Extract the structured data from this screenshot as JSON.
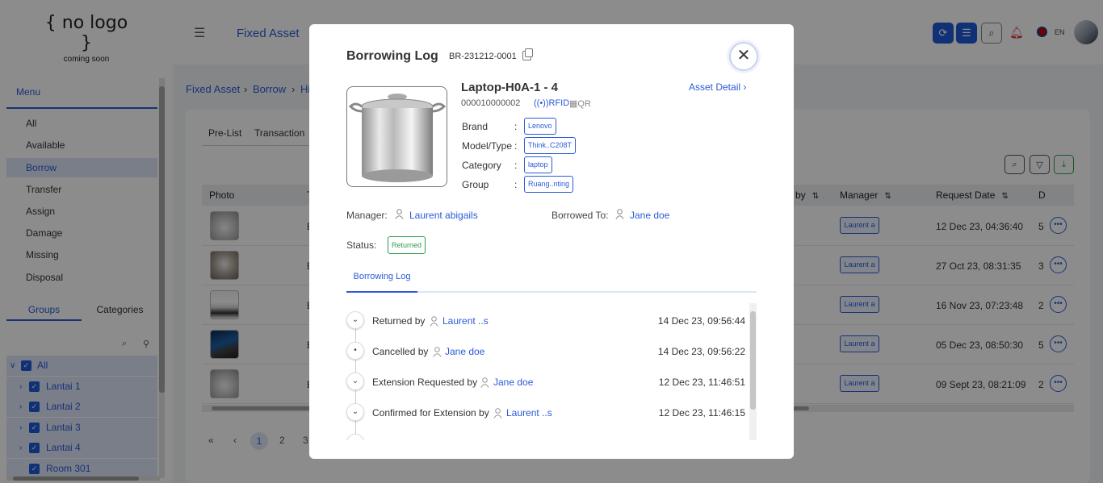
{
  "header": {
    "logo_line1": "{ no logo }",
    "logo_line2": "coming soon",
    "app_title": "Fixed Asset",
    "language": "EN"
  },
  "sidebar": {
    "menu_title": "Menu",
    "items": [
      "All",
      "Available",
      "Borrow",
      "Transfer",
      "Assign",
      "Damage",
      "Missing",
      "Disposal"
    ],
    "tabs": [
      "Groups",
      "Categories"
    ],
    "tree": [
      "All",
      "Lantai 1",
      "Lantai 2",
      "Lantai 3",
      "Lantai 4",
      "Room 301"
    ]
  },
  "main": {
    "breadcrumb": [
      "Fixed Asset",
      "Borrow",
      "Hi"
    ],
    "tabs": [
      "Pre-List",
      "Transaction"
    ],
    "table_headers": [
      "Photo",
      "T",
      "by",
      "Manager",
      "Request Date",
      "D"
    ],
    "rows": [
      {
        "b": "E",
        "manager": "Laurent a",
        "date": "12 Dec 23, 04:36:40",
        "d": "5"
      },
      {
        "b": "E",
        "manager": "Laurent a",
        "date": "27 Oct 23, 08:31:35",
        "d": "3"
      },
      {
        "b": "E",
        "manager": "Laurent a",
        "date": "16 Nov 23, 07:23:48",
        "d": "2"
      },
      {
        "b": "E",
        "manager": "Laurent a",
        "date": "05 Dec 23, 08:50:30",
        "d": "5"
      },
      {
        "b": "E",
        "manager": "Laurent a",
        "date": "09 Sept 23, 08:21:09",
        "d": "2"
      }
    ],
    "pagination": [
      "1",
      "2",
      "3"
    ]
  },
  "modal": {
    "title": "Borrowing Log",
    "code": "BR-231212-0001",
    "asset_name": "Laptop-H0A-1 - 4",
    "serial": "000010000002",
    "rfid_label": "RFID",
    "qr_label": "QR",
    "asset_detail": "Asset Detail",
    "attributes": [
      {
        "label": "Brand",
        "value": "Lenovo"
      },
      {
        "label": "Model/Type",
        "value": "Think..C208T"
      },
      {
        "label": "Category",
        "value": "laptop"
      },
      {
        "label": "Group",
        "value": "Ruang..nting"
      }
    ],
    "manager_label": "Manager:",
    "manager": "Laurent abigails",
    "borrowed_to_label": "Borrowed To:",
    "borrowed_to": "Jane doe",
    "status_label": "Status:",
    "status": "Returned",
    "log_tab": "Borrowing Log",
    "log": [
      {
        "action": "Returned by",
        "user": "Laurent ..s",
        "time": "14 Dec 23, 09:56:44",
        "icon": "chevron-down-icon"
      },
      {
        "action": "Cancelled by",
        "user": "Jane doe",
        "time": "14 Dec 23, 09:56:22",
        "icon": "dot-icon"
      },
      {
        "action": "Extension Requested by",
        "user": "Jane doe",
        "time": "12 Dec 23, 11:46:51",
        "icon": "chevron-down-icon"
      },
      {
        "action": "Confirmed for Extension by",
        "user": "Laurent ..s",
        "time": "12 Dec 23, 11:46:15",
        "icon": "chevron-down-icon"
      }
    ]
  },
  "colors": {
    "accent": "#2a5bd7",
    "status_green": "#2e9b4f",
    "overlay": "rgba(0,0,0,0.45)"
  }
}
